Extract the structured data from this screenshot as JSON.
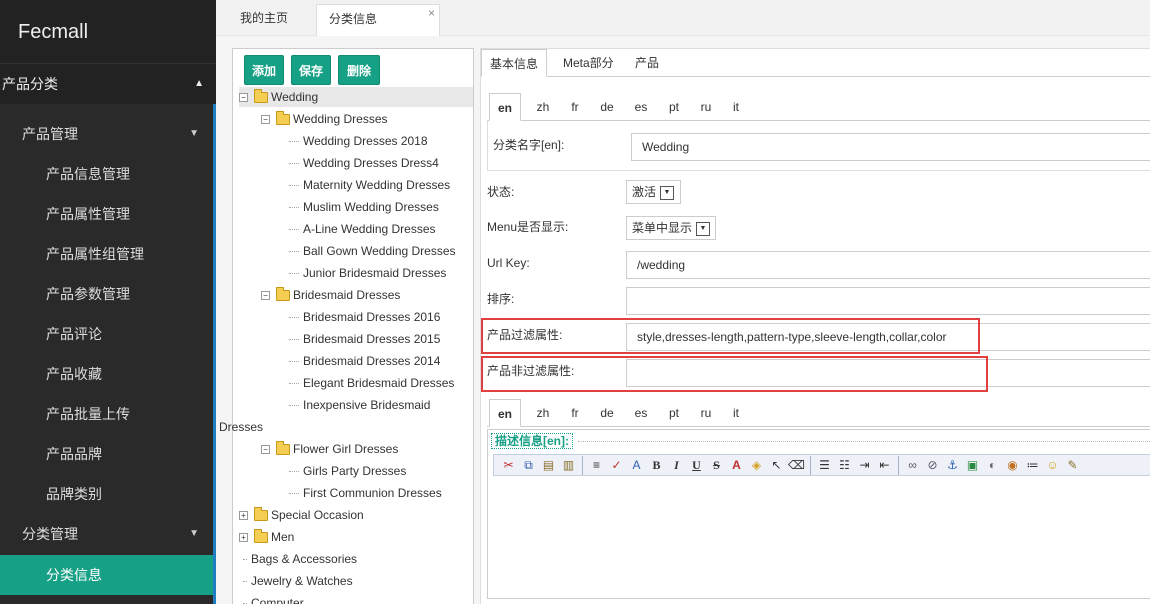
{
  "sidebar": {
    "brand": "Fecmall",
    "section": "产品分类",
    "items": [
      {
        "label": "产品管理",
        "level": 1
      },
      {
        "label": "产品信息管理",
        "level": 2
      },
      {
        "label": "产品属性管理",
        "level": 2
      },
      {
        "label": "产品属性组管理",
        "level": 2
      },
      {
        "label": "产品参数管理",
        "level": 2
      },
      {
        "label": "产品评论",
        "level": 2
      },
      {
        "label": "产品收藏",
        "level": 2
      },
      {
        "label": "产品批量上传",
        "level": 2
      },
      {
        "label": "产品品牌",
        "level": 2
      },
      {
        "label": "品牌类别",
        "level": 2
      },
      {
        "label": "分类管理",
        "level": 1
      },
      {
        "label": "分类信息",
        "level": 2,
        "active": true
      }
    ]
  },
  "tabs": {
    "home": "我的主页",
    "category": "分类信息",
    "close": "×"
  },
  "tree": {
    "buttons": {
      "add": "添加",
      "save": "保存",
      "delete": "删除"
    },
    "nodes": {
      "wedding": "Wedding",
      "wedding_dresses": "Wedding Dresses",
      "wd_2018": "Wedding Dresses 2018",
      "wd_dress4": "Wedding Dresses Dress4",
      "maternity": "Maternity Wedding Dresses",
      "muslim": "Muslim Wedding Dresses",
      "aline": "A-Line Wedding Dresses",
      "ballgown": "Ball Gown Wedding Dresses",
      "junior": "Junior Bridesmaid Dresses",
      "bridesmaid": "Bridesmaid Dresses",
      "bd_2016": "Bridesmaid Dresses 2016",
      "bd_2015": "Bridesmaid Dresses 2015",
      "bd_2014": "Bridesmaid Dresses 2014",
      "elegant": "Elegant Bridesmaid Dresses",
      "inexpensive": "Inexpensive Bridesmaid",
      "inexpensive_wrap": "Dresses",
      "flower": "Flower Girl Dresses",
      "girls_party": "Girls Party Dresses",
      "first_communion": "First Communion Dresses",
      "special": "Special Occasion",
      "men": "Men",
      "bags": "Bags & Accessories",
      "jewelry": "Jewelry & Watches",
      "computer": "Computer"
    }
  },
  "form": {
    "tabs": {
      "basic": "基本信息",
      "meta": "Meta部分",
      "products": "产品"
    },
    "langs": [
      "en",
      "zh",
      "fr",
      "de",
      "es",
      "pt",
      "ru",
      "it"
    ],
    "name_label": "分类名字[en]:",
    "name_value": "Wedding",
    "status_label": "状态:",
    "status_value": "激活",
    "menu_label": "Menu是否显示:",
    "menu_value": "菜单中显示",
    "urlkey_label": "Url Key:",
    "urlkey_value": "/wedding",
    "sort_label": "排序:",
    "sort_value": "",
    "filter_label": "产品过滤属性:",
    "filter_value": "style,dresses-length,pattern-type,sleeve-length,collar,color",
    "nonfilter_label": "产品非过滤属性:",
    "nonfilter_value": "",
    "desc_label": "描述信息[en]:"
  }
}
